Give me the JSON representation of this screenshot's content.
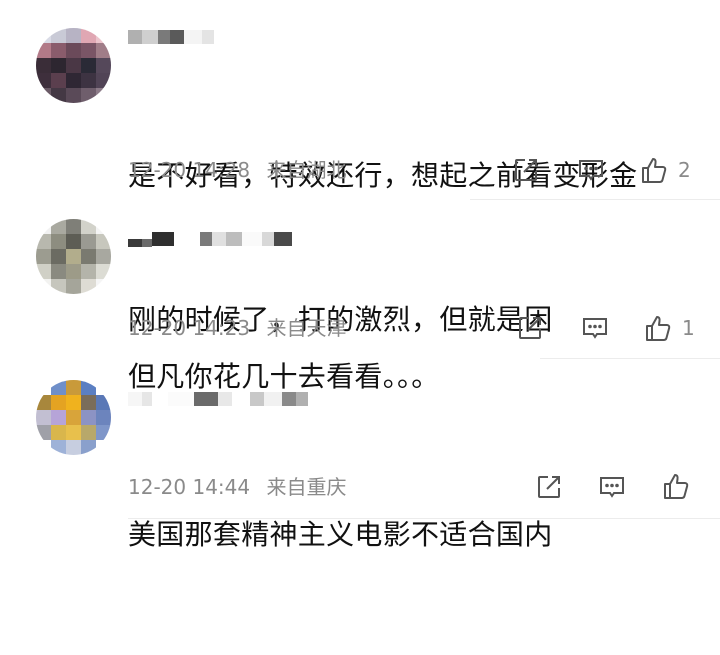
{
  "comments": [
    {
      "text_lines": [
        "是不好看，特效还行，想起之前看变形金",
        "刚的时候了，打的激烈，但就是困"
      ],
      "time": "12-20 14:28",
      "location": "来自湖北",
      "likes": "2",
      "icons": [
        "share-icon",
        "comment-icon",
        "like-icon"
      ]
    },
    {
      "text_lines": [
        "但凡你花几十去看看。。。"
      ],
      "time": "12-20 14:23",
      "location": "来自天津",
      "likes": "1",
      "icons": [
        "share-icon",
        "comment-icon",
        "like-icon"
      ]
    },
    {
      "text_lines": [
        "美国那套精神主义电影不适合国内"
      ],
      "time": "12-20 14:44",
      "location": "来自重庆",
      "likes": "",
      "icons": [
        "share-icon",
        "comment-icon",
        "like-icon"
      ]
    }
  ],
  "colors": {
    "text": "#111111",
    "meta": "#8a8a8a",
    "icon": "#555555",
    "divider": "#ececec"
  }
}
